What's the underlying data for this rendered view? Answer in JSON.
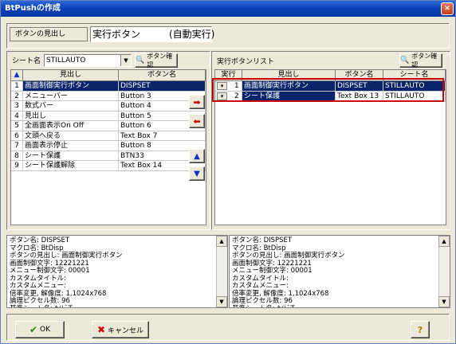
{
  "window": {
    "title": "BtPushの作成",
    "close_glyph": "×"
  },
  "caption_row": {
    "label": "ボタンの見出し",
    "value": "実行ボタン　　　(自動実行)"
  },
  "left": {
    "sheet_label": "シート名",
    "sheet_value": "STILLAUTO",
    "confirm_button": "ボタン確認",
    "headers": [
      "▲",
      "見出し",
      "ボタン名"
    ],
    "rows": [
      {
        "num": "1",
        "caption": "画面制御実行ボタン",
        "name": "DISPSET"
      },
      {
        "num": "2",
        "caption": "メニューバー",
        "name": "Button 3"
      },
      {
        "num": "3",
        "caption": "数式バー",
        "name": "Button 4"
      },
      {
        "num": "4",
        "caption": "見出し",
        "name": "Button 5"
      },
      {
        "num": "5",
        "caption": "全画面表示On Off",
        "name": "Button 6"
      },
      {
        "num": "6",
        "caption": "文頭へ戻る",
        "name": "Text Box 7"
      },
      {
        "num": "7",
        "caption": "画面表示停止",
        "name": "Button 8"
      },
      {
        "num": "8",
        "caption": "シート保護",
        "name": "BTN33"
      },
      {
        "num": "9",
        "caption": "シート保護解除",
        "name": "Text Box 14"
      }
    ]
  },
  "right": {
    "list_label": "実行ボタンリスト",
    "confirm_button": "ボタン確認",
    "headers": [
      "実行",
      "見出し",
      "ボタン名",
      "シート名"
    ],
    "rows": [
      {
        "num": "1",
        "caption": "画面制御実行ボタン",
        "name": "DISPSET",
        "sheet": "STILLAUTO"
      },
      {
        "num": "2",
        "caption": "シート保護",
        "name": "Text Box 13",
        "sheet": "STILLAUTO"
      }
    ]
  },
  "arrows": {
    "add": "➡",
    "remove": "⬅",
    "up": "▲",
    "down": "▼"
  },
  "memo_left": [
    "ボタン名: DISPSET",
    "マクロ名: BtDisp",
    "ボタンの見出し: 画面制御実行ボタン",
    "画面制御文字: 12221221",
    "メニュー制御文字: 00001",
    "カスタムタイトル:",
    "カスタムメニュー:",
    "倍率変更, 解像度: 1,1024x768",
    "論理ピクセル数: 96",
    "基準シート名: ｶｲﾄﾞT"
  ],
  "memo_right": [
    "ボタン名: DISPSET",
    "マクロ名: BtDisp",
    "ボタンの見出し: 画面制御実行ボタン",
    "画面制御文字: 12221221",
    "メニュー制御文字: 00001",
    "カスタムタイトル:",
    "カスタムメニュー:",
    "倍率変更, 解像度: 1,1024x768",
    "論理ピクセル数: 96",
    "基準シート名: ｶｲﾄﾞT"
  ],
  "footer": {
    "ok": "OK",
    "cancel": "キャンセル",
    "help": "?"
  },
  "colors": {
    "select": "#0a246a",
    "highlight_border": "#cc0000",
    "arrow_red": "#cc0000",
    "arrow_blue": "#1030c0"
  }
}
